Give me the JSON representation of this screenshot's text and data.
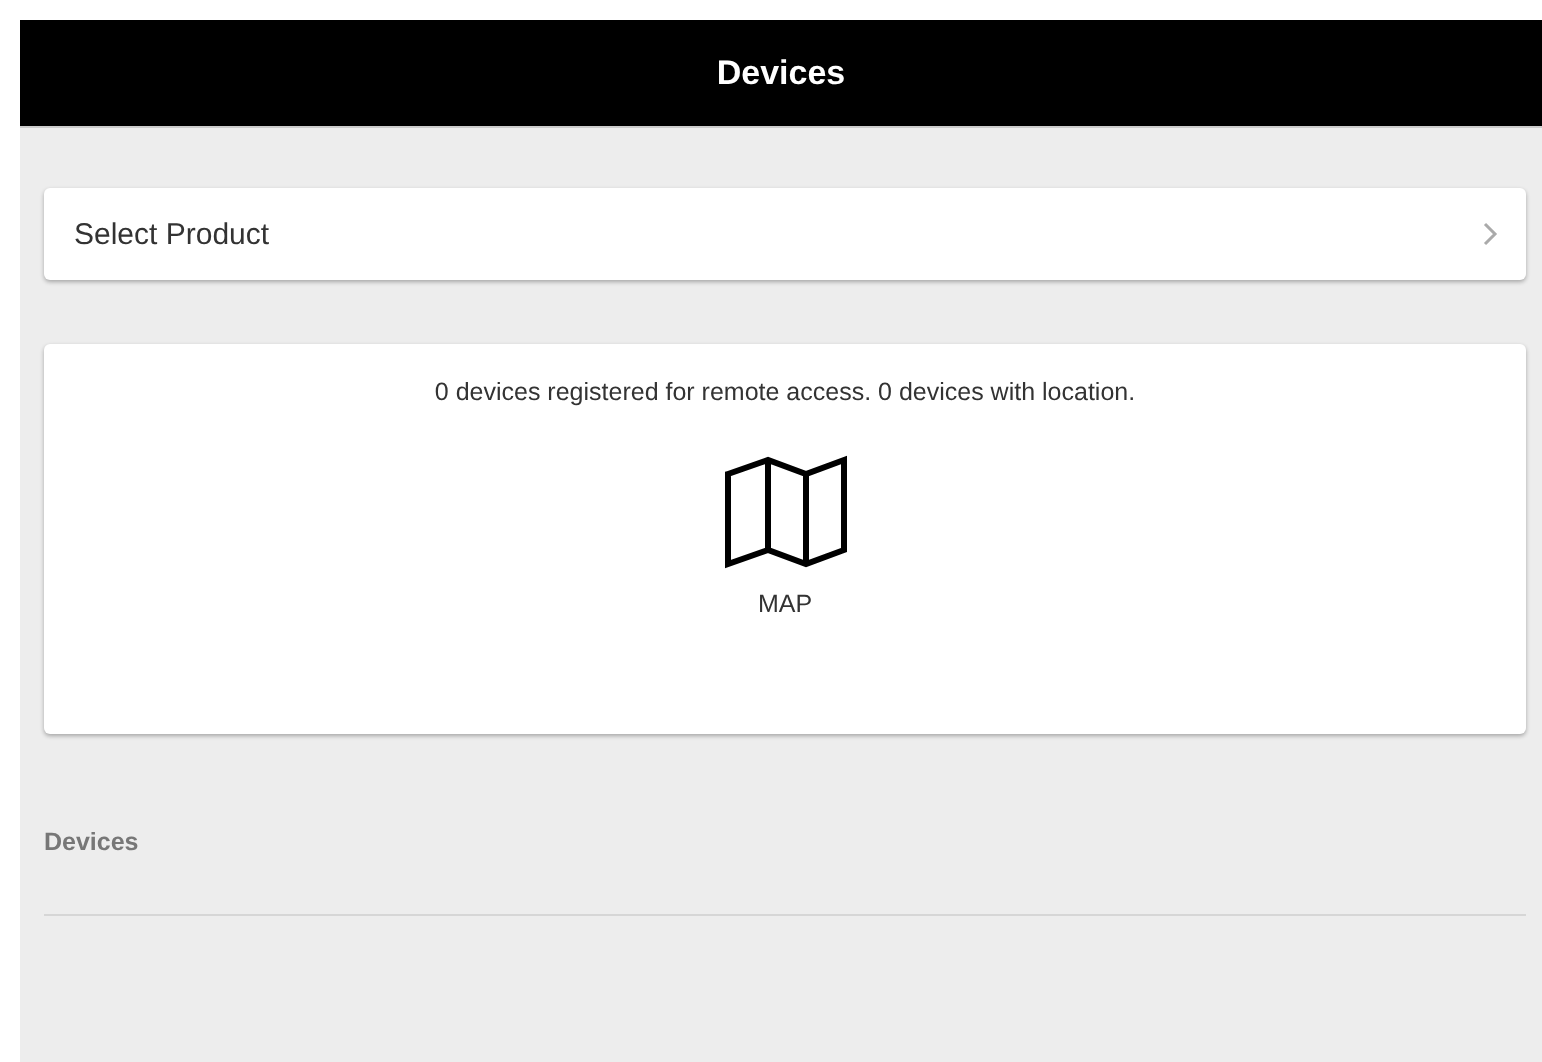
{
  "header": {
    "title": "Devices"
  },
  "product_select": {
    "label": "Select Product"
  },
  "summary": {
    "text": "0 devices registered for remote access. 0 devices with location.",
    "map_label": "MAP"
  },
  "section": {
    "title": "Devices"
  }
}
